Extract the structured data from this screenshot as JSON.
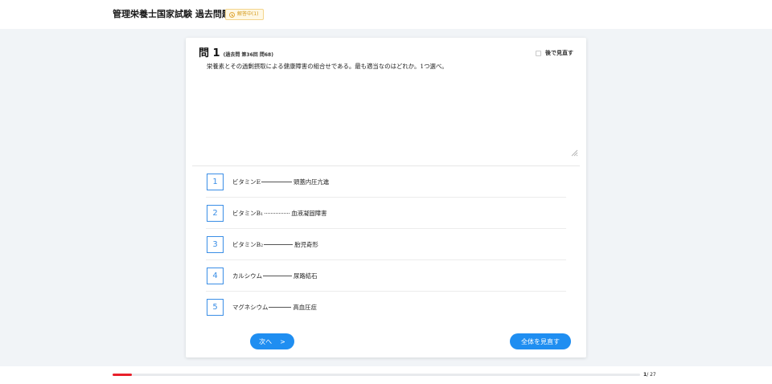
{
  "header": {
    "title": "管理栄養士国家試験 過去問題",
    "badge_label": "解答中(1)"
  },
  "question": {
    "number_label": "問 1",
    "source_label": "(過去問 第36回 問68)",
    "review_later_label": "後で見直す",
    "text": "栄養素とその過剰摂取による健康障害の組合せである。最も適当なのはどれか。1つ選べ。"
  },
  "options": [
    {
      "num": "1",
      "name": "ビタミンE",
      "sub": "",
      "effect": "頭蓋内圧亢進"
    },
    {
      "num": "2",
      "name": "ビタミンB",
      "sub": "1",
      "effect": "血液凝固障害"
    },
    {
      "num": "3",
      "name": "ビタミンB",
      "sub": "2",
      "effect": "胎児奇形"
    },
    {
      "num": "4",
      "name": "カルシウム",
      "sub": "",
      "effect": "尿路結石"
    },
    {
      "num": "5",
      "name": "マグネシウム",
      "sub": "",
      "effect": "高血圧症"
    }
  ],
  "buttons": {
    "next_label": "次へ",
    "next_arrow": ">",
    "review_all_label": "全体を見直す"
  },
  "progress": {
    "current": "1",
    "total": "/ 27",
    "fraction": 0.037
  },
  "colors": {
    "accent": "#1f8ef1",
    "progress": "#e8202a",
    "badge": "#d39a1c"
  }
}
